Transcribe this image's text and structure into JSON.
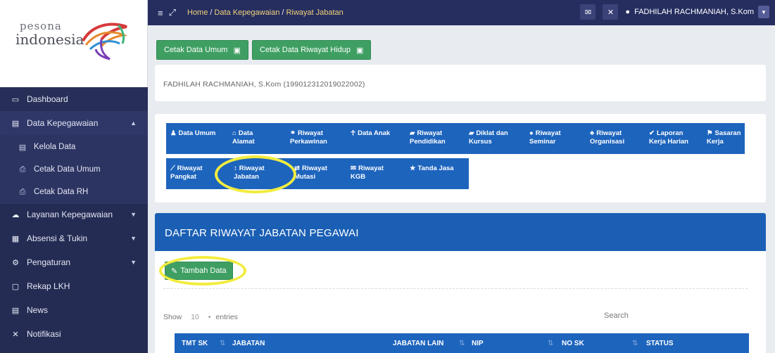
{
  "logo": {
    "line1": "pesona",
    "line2": "indonesia"
  },
  "topbar": {
    "breadcrumb": [
      "Home",
      "Data Kepegawaian",
      "Riwayat Jabatan"
    ],
    "user": "FADHILAH RACHMANIAH, S.Kom"
  },
  "sidebar": {
    "items": [
      {
        "label": "Dashboard",
        "icon": "monitor-icon"
      },
      {
        "label": "Data Kepegawaian",
        "icon": "id-card-icon"
      },
      {
        "label": "Kelola Data",
        "icon": "id-card-icon"
      },
      {
        "label": "Cetak Data Umum",
        "icon": "printer-icon"
      },
      {
        "label": "Cetak Data RH",
        "icon": "printer-icon"
      },
      {
        "label": "Layanan Kepegawaian",
        "icon": "cloud-icon"
      },
      {
        "label": "Absensi & Tukin",
        "icon": "table-icon"
      },
      {
        "label": "Pengaturan",
        "icon": "gear-icon"
      },
      {
        "label": "Rekap LKH",
        "icon": "document-icon"
      },
      {
        "label": "News",
        "icon": "newspaper-icon"
      },
      {
        "label": "Notifikasi",
        "icon": "bell-slash-icon"
      }
    ]
  },
  "actions": {
    "cetak_umum": "Cetak Data Umum",
    "cetak_rh": "Cetak Data Riwayat Hidup"
  },
  "employee": {
    "name_nip": "FADHILAH RACHMANIAH, S.Kom (199012312019022002)"
  },
  "tabs": [
    {
      "line1": "Data Umum",
      "line2": ""
    },
    {
      "line1": "Data",
      "line2": "Alamat"
    },
    {
      "line1": "Riwayat",
      "line2": "Perkawinan"
    },
    {
      "line1": "Data Anak",
      "line2": ""
    },
    {
      "line1": "Riwayat",
      "line2": "Pendidikan"
    },
    {
      "line1": "Diklat dan",
      "line2": "Kursus"
    },
    {
      "line1": "Riwayat",
      "line2": "Seminar"
    },
    {
      "line1": "Riwayat",
      "line2": "Organisasi"
    },
    {
      "line1": "Laporan",
      "line2": "Kerja Harian"
    },
    {
      "line1": "Sasaran",
      "line2": "Kerja"
    },
    {
      "line1": "Riwayat",
      "line2": "Pangkat"
    },
    {
      "line1": "Riwayat",
      "line2": "Jabatan"
    },
    {
      "line1": "Riwayat",
      "line2": "Mutasi"
    },
    {
      "line1": "Riwayat",
      "line2": "KGB"
    },
    {
      "line1": "Tanda Jasa",
      "line2": ""
    }
  ],
  "section": {
    "title": "DAFTAR RIWAYAT JABATAN PEGAWAI",
    "add_button": "Tambah Data"
  },
  "table": {
    "show_label": "Show",
    "page_size": "10",
    "entries_label": "entries",
    "search_label": "Search",
    "columns": [
      "TMT SK",
      "JABATAN",
      "JABATAN LAIN",
      "NIP",
      "NO SK",
      "STATUS"
    ]
  }
}
